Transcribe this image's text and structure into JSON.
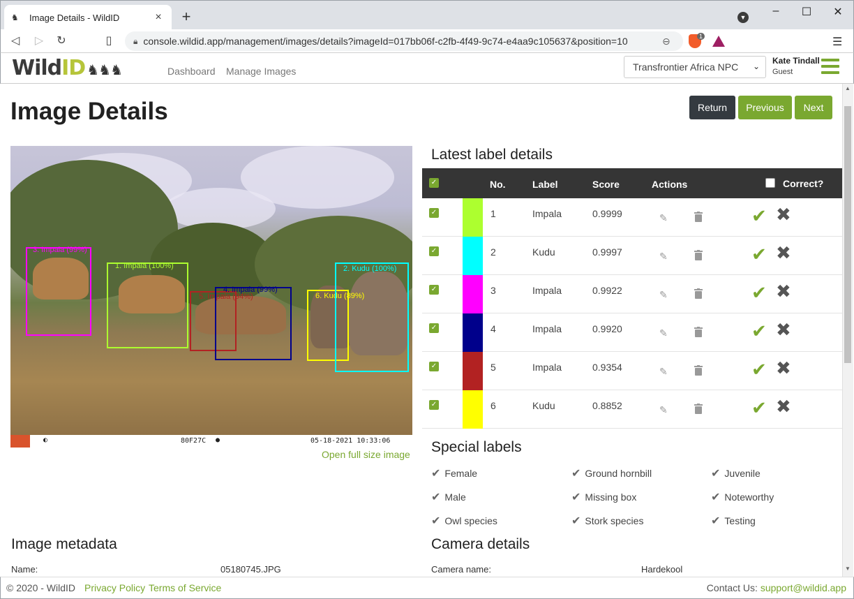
{
  "browser": {
    "tab_title": "Image Details - WildID",
    "url": "console.wildid.app/management/images/details?imageId=017bb06f-c2fb-4f49-9c74-e4aa9c105637&position=10",
    "brave_badge": "1"
  },
  "header": {
    "logo_text": "Wild",
    "logo_accent": "ID",
    "nav": [
      "Dashboard",
      "Manage Images"
    ],
    "organization": "Transfrontier Africa NPC",
    "user_name": "Kate Tindall",
    "user_role": "Guest"
  },
  "page": {
    "title": "Image Details",
    "buttons": {
      "return": "Return",
      "previous": "Previous",
      "next": "Next"
    },
    "open_full": "Open full size image"
  },
  "photo": {
    "timestamp": "05-18-2021 10:33:06",
    "camera_code": "80F27C",
    "boxes": [
      {
        "label": "1. Impala (100%)",
        "color": "#adff2f"
      },
      {
        "label": "2. Kudu (100%)",
        "color": "#00ffff"
      },
      {
        "label": "3. Impala (99%)",
        "color": "#ff00ff"
      },
      {
        "label": "4. Impala (99%)",
        "color": "#00008b"
      },
      {
        "label": "5. Impala (94%)",
        "color": "#b22222"
      },
      {
        "label": "6. Kudu (89%)",
        "color": "#ffff00"
      }
    ]
  },
  "labels": {
    "title": "Latest label details",
    "columns": {
      "no": "No.",
      "label": "Label",
      "score": "Score",
      "actions": "Actions",
      "correct": "Correct?"
    },
    "rows": [
      {
        "no": "1",
        "label": "Impala",
        "score": "0.9999",
        "color": "#adff2f"
      },
      {
        "no": "2",
        "label": "Kudu",
        "score": "0.9997",
        "color": "#00ffff"
      },
      {
        "no": "3",
        "label": "Impala",
        "score": "0.9922",
        "color": "#ff00ff"
      },
      {
        "no": "4",
        "label": "Impala",
        "score": "0.9920",
        "color": "#00008b"
      },
      {
        "no": "5",
        "label": "Impala",
        "score": "0.9354",
        "color": "#b22222"
      },
      {
        "no": "6",
        "label": "Kudu",
        "score": "0.8852",
        "color": "#ffff00"
      }
    ]
  },
  "special": {
    "title": "Special labels",
    "items": [
      "Female",
      "Ground hornbill",
      "Juvenile",
      "Male",
      "Missing box",
      "Noteworthy",
      "Owl species",
      "Stork species",
      "Testing"
    ]
  },
  "metadata": {
    "title": "Image metadata",
    "name_key": "Name:",
    "name_val": "05180745.JPG"
  },
  "camera": {
    "title": "Camera details",
    "name_key": "Camera name:",
    "name_val": "Hardekool"
  },
  "footer": {
    "copyright": "© 2020 - WildID",
    "privacy": "Privacy Policy",
    "terms": "Terms of Service",
    "contact": "Contact Us: ",
    "email": "support@wildid.app"
  }
}
